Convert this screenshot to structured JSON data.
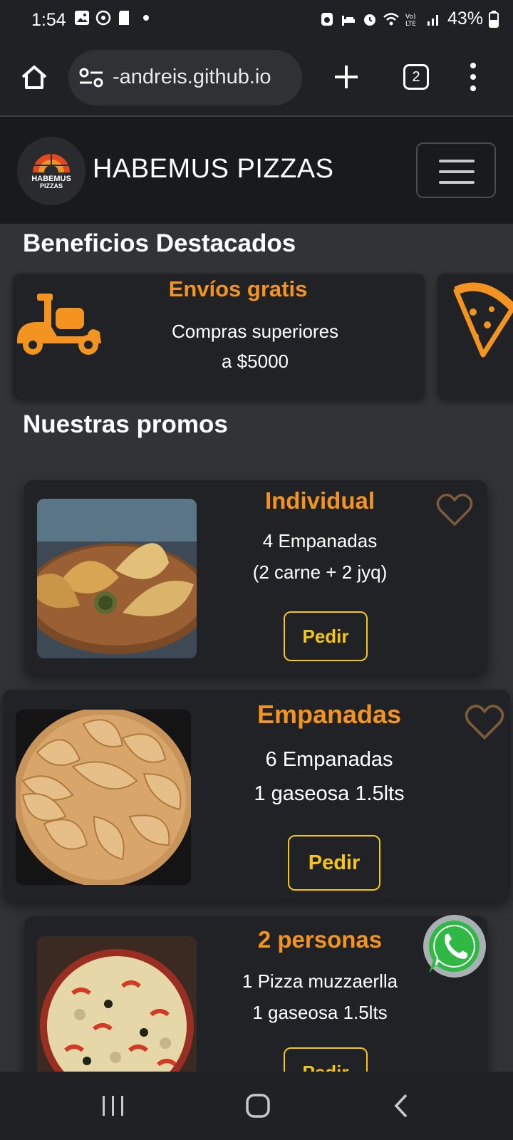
{
  "status_bar": {
    "time": "1:54",
    "battery": "43%",
    "icons": [
      "image-icon",
      "sync-icon",
      "sd-card-icon",
      "dot-icon",
      "recycle-icon",
      "sleep-icon",
      "alarm-icon",
      "wifi-icon",
      "volte-icon",
      "signal-icon",
      "battery-icon"
    ]
  },
  "browser": {
    "url": "-andreis.github.io",
    "tab_count": "2"
  },
  "navbar": {
    "brand": "HABEMUS PIZZAS",
    "logo_line1": "HABEMUS",
    "logo_line2": "PIZZAS"
  },
  "benefits": {
    "title": "Beneficios Destacados",
    "items": [
      {
        "title": "Envíos gratis",
        "line1": "Compras superiores",
        "line2": "a $5000",
        "icon": "delivery-scooter-icon"
      },
      {
        "title": "",
        "line1": "",
        "line2": "",
        "icon": "pizza-slice-icon"
      }
    ]
  },
  "promos": {
    "title": "Nuestras promos",
    "items": [
      {
        "title": "Individual",
        "line1": "4 Empanadas",
        "line2": "(2 carne + 2 jyq)",
        "button": "Pedir",
        "image": "empanadas-board-photo"
      },
      {
        "title": "Empanadas",
        "line1": "6 Empanadas",
        "line2": "1 gaseosa 1.5lts",
        "button": "Pedir",
        "image": "empanadas-round-tray-photo"
      },
      {
        "title": "2 personas",
        "line1": "1 Pizza muzzaerlla",
        "line2": "1 gaseosa 1.5lts",
        "button": "Pedir",
        "image": "pizza-photo"
      }
    ]
  },
  "colors": {
    "accent": "#f39420",
    "button": "#f5c518",
    "card": "#212226",
    "page_bg": "#323335"
  }
}
